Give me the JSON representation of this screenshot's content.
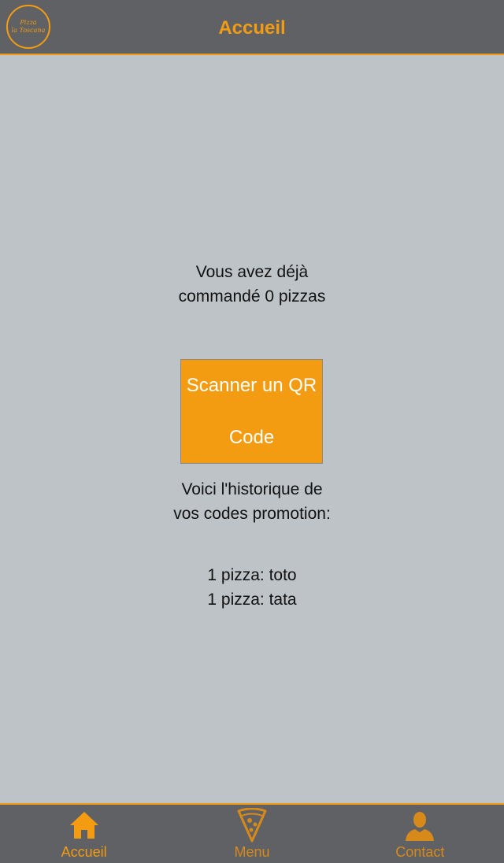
{
  "header": {
    "logo_line1": "Pizza",
    "logo_line2": "la Toscana",
    "title": "Accueil"
  },
  "main": {
    "orders_text": "Vous avez déjà commandé 0 pizzas",
    "scan_button_label": "Scanner un QR Code",
    "history_text": "Voici l'historique de vos codes promotion:",
    "promo_codes": [
      "1 pizza: toto",
      "1 pizza: tata"
    ]
  },
  "tabbar": {
    "tabs": [
      {
        "label": "Accueil",
        "icon": "home-icon",
        "active": true
      },
      {
        "label": "Menu",
        "icon": "pizza-slice-icon",
        "active": false
      },
      {
        "label": "Contact",
        "icon": "person-icon",
        "active": false
      }
    ]
  },
  "colors": {
    "accent": "#f39c12",
    "bar": "#5f6164",
    "background": "#bec3c7"
  }
}
